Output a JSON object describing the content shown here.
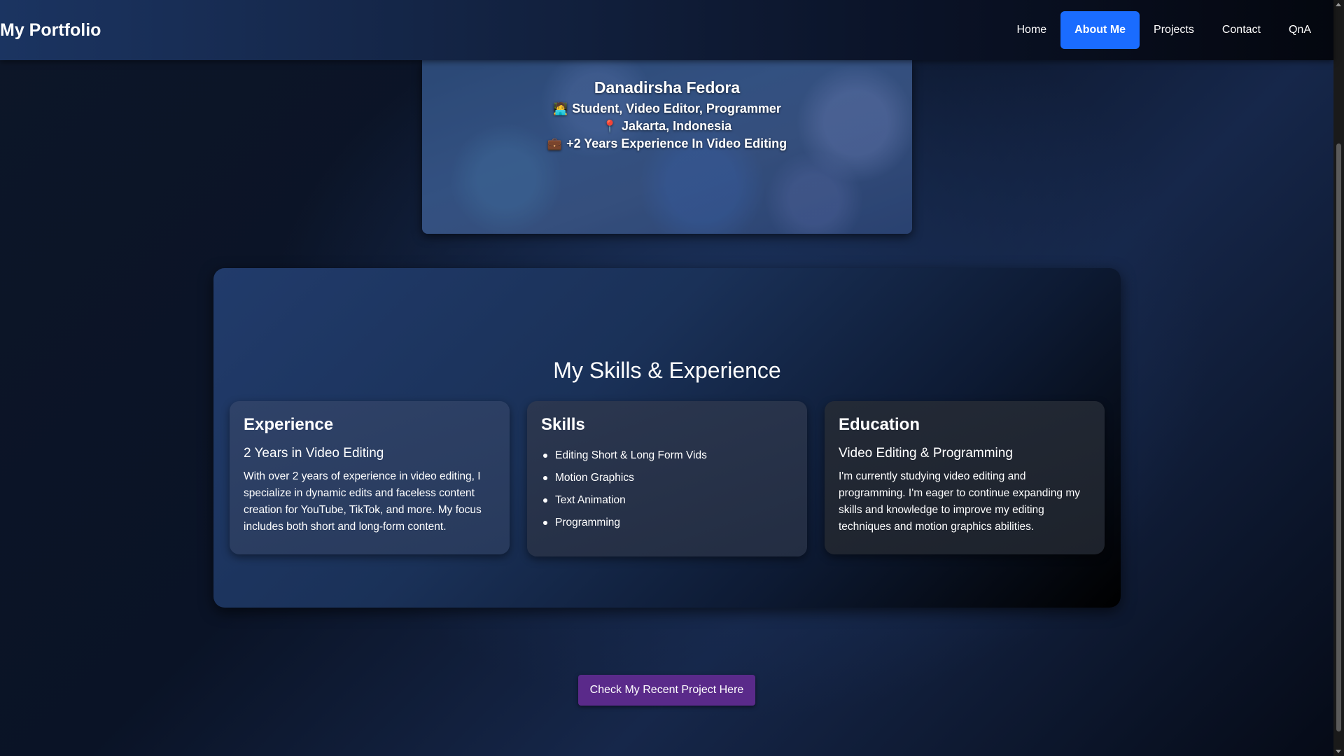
{
  "nav": {
    "brand": "My Portfolio",
    "links": [
      {
        "label": "Home"
      },
      {
        "label": "About Me",
        "active": true
      },
      {
        "label": "Projects"
      },
      {
        "label": "Contact"
      },
      {
        "label": "QnA"
      }
    ]
  },
  "profile": {
    "name": "Danadirsha Fedora",
    "role_icon": "🧑‍💻",
    "role": "Student, Video Editor, Programmer",
    "location_icon": "📍",
    "location": "Jakarta, Indonesia",
    "experience_icon": "💼",
    "experience": "+2 Years Experience In Video Editing"
  },
  "skills_section": {
    "title": "My Skills & Experience",
    "experience_card": {
      "title": "Experience",
      "subtitle": "2 Years in Video Editing",
      "text": "With over 2 years of experience in video editing, I specialize in dynamic edits and faceless content creation for YouTube, TikTok, and more. My focus includes both short and long-form content."
    },
    "skills_card": {
      "title": "Skills",
      "items": [
        "Editing Short & Long Form Vids",
        "Motion Graphics",
        "Text Animation",
        "Programming"
      ]
    },
    "education_card": {
      "title": "Education",
      "subtitle": "Video Editing & Programming",
      "text": "I'm currently studying video editing and programming. I'm eager to continue expanding my skills and knowledge to improve my editing techniques and motion graphics abilities."
    }
  },
  "cta": {
    "label": "Check My Recent Project Here",
    "color": "#5a2a8a"
  },
  "colors": {
    "accent": "#1a6cff"
  }
}
